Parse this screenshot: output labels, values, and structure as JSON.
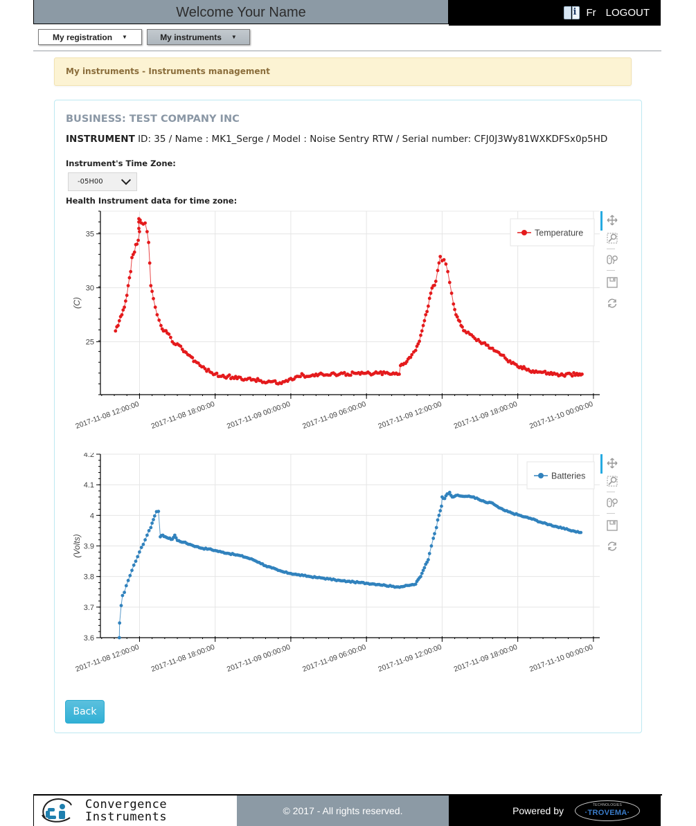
{
  "header": {
    "welcome": "Welcome  Your Name",
    "help_icon": "book-info-icon",
    "language": "Fr",
    "logout": "LOGOUT"
  },
  "menu": {
    "items": [
      {
        "label": "My registration",
        "icon": "caret-down-icon"
      },
      {
        "label": "My instruments",
        "icon": "caret-down-icon"
      }
    ]
  },
  "alert": {
    "text": "My instruments - Instruments management"
  },
  "panel": {
    "business": "BUSINESS: TEST COMPANY INC",
    "instrument_label": "INSTRUMENT",
    "instrument_details": " ID: 35 / Name : MK1_Serge / Model : Noise Sentry RTW / Serial number: CFJ0J3Wy81WXKDFSx0p5HD",
    "timezone_label": "Instrument's Time Zone:",
    "timezone_value": "-05H00",
    "health_label": "Health Instrument data for time zone:",
    "back_label": "Back"
  },
  "toolbar": {
    "tools": [
      "pan-icon",
      "box-zoom-icon",
      "wheel-zoom-icon",
      "save-icon",
      "reset-icon"
    ]
  },
  "chart_data": [
    {
      "type": "line",
      "title": "",
      "xlabel": "",
      "ylabel": "(C)",
      "legend": {
        "label": "Temperature",
        "placement": "top-right"
      },
      "color": "#e41a1c",
      "grid": true,
      "x_unit": "hours since 2017-11-08 12:00:00",
      "xlim": [
        -3.1,
        36.5
      ],
      "ylim": [
        20.1,
        37.1
      ],
      "x_ticks": [
        {
          "at": 0,
          "label": "2017-11-08 12:00:00"
        },
        {
          "at": 6,
          "label": "2017-11-08 18:00:00"
        },
        {
          "at": 12,
          "label": "2017-11-09 00:00:00"
        },
        {
          "at": 18,
          "label": "2017-11-09 06:00:00"
        },
        {
          "at": 24,
          "label": "2017-11-09 12:00:00"
        },
        {
          "at": 30,
          "label": "2017-11-09 18:00:00"
        },
        {
          "at": 36,
          "label": "2017-11-10 00:00:00"
        }
      ],
      "y_ticks": [
        25,
        30,
        35
      ],
      "series": [
        {
          "name": "Temperature",
          "points": [
            [
              -1.9,
              26.0
            ],
            [
              -1.7,
              26.5
            ],
            [
              -1.4,
              27.5
            ],
            [
              -1.2,
              28.2
            ],
            [
              -1.0,
              29.3
            ],
            [
              -0.9,
              30.2
            ],
            [
              -0.7,
              31.5
            ],
            [
              -0.6,
              32.8
            ],
            [
              -0.4,
              33.3
            ],
            [
              -0.3,
              34.0
            ],
            [
              -0.1,
              34.4
            ],
            [
              0.0,
              35.2
            ],
            [
              -0.05,
              35.5
            ],
            [
              -0.05,
              36.1
            ],
            [
              -0.05,
              36.4
            ],
            [
              0.15,
              36.0
            ],
            [
              0.3,
              35.9
            ],
            [
              0.45,
              36.0
            ],
            [
              0.6,
              35.2
            ],
            [
              0.72,
              34.2
            ],
            [
              0.9,
              30.2
            ],
            [
              1.1,
              29.0
            ],
            [
              1.25,
              28.2
            ],
            [
              1.4,
              27.5
            ],
            [
              1.55,
              27.0
            ],
            [
              1.7,
              26.5
            ],
            [
              1.9,
              26.0
            ],
            [
              2.2,
              25.8
            ],
            [
              2.6,
              25.0
            ],
            [
              3.0,
              24.8
            ],
            [
              3.4,
              24.3
            ],
            [
              3.7,
              24.0
            ],
            [
              4.1,
              23.6
            ],
            [
              4.4,
              23.2
            ],
            [
              4.8,
              22.8
            ],
            [
              5.2,
              22.5
            ],
            [
              5.6,
              22.2
            ],
            [
              6.0,
              22.0
            ],
            [
              6.5,
              21.8
            ],
            [
              7.0,
              21.8
            ],
            [
              7.5,
              21.6
            ],
            [
              8.0,
              21.7
            ],
            [
              8.5,
              21.5
            ],
            [
              9.0,
              21.5
            ],
            [
              9.5,
              21.4
            ],
            [
              10.0,
              21.2
            ],
            [
              10.5,
              21.3
            ],
            [
              11.0,
              21.1
            ],
            [
              11.5,
              21.3
            ],
            [
              12.0,
              21.6
            ],
            [
              12.5,
              21.8
            ],
            [
              13.0,
              21.9
            ],
            [
              13.5,
              21.8
            ],
            [
              14.0,
              22.0
            ],
            [
              14.5,
              22.0
            ],
            [
              15.0,
              21.9
            ],
            [
              15.5,
              22.0
            ],
            [
              16.0,
              22.1
            ],
            [
              16.5,
              22.0
            ],
            [
              17.0,
              22.1
            ],
            [
              17.5,
              22.0
            ],
            [
              18.0,
              22.1
            ],
            [
              18.5,
              22.0
            ],
            [
              19.0,
              22.1
            ],
            [
              19.5,
              22.1
            ],
            [
              20.0,
              22.0
            ],
            [
              20.6,
              22.0
            ],
            [
              20.7,
              22.8
            ],
            [
              21.0,
              23.0
            ],
            [
              21.3,
              23.4
            ],
            [
              21.6,
              23.8
            ],
            [
              21.9,
              24.2
            ],
            [
              22.1,
              24.8
            ],
            [
              22.3,
              25.6
            ],
            [
              22.5,
              26.5
            ],
            [
              22.7,
              27.5
            ],
            [
              22.9,
              28.3
            ],
            [
              23.1,
              29.5
            ],
            [
              23.3,
              30.2
            ],
            [
              23.5,
              30.6
            ],
            [
              23.65,
              31.6
            ],
            [
              23.75,
              32.3
            ],
            [
              23.85,
              32.9
            ],
            [
              24.0,
              32.5
            ],
            [
              24.15,
              32.6
            ],
            [
              24.3,
              32.2
            ],
            [
              24.45,
              31.5
            ],
            [
              24.6,
              30.5
            ],
            [
              24.75,
              29.5
            ],
            [
              24.9,
              28.5
            ],
            [
              25.1,
              27.5
            ],
            [
              25.3,
              27.0
            ],
            [
              25.5,
              26.5
            ],
            [
              25.8,
              26.0
            ],
            [
              26.2,
              25.7
            ],
            [
              26.6,
              25.3
            ],
            [
              27.0,
              25.0
            ],
            [
              27.5,
              24.7
            ],
            [
              28.0,
              24.4
            ],
            [
              28.5,
              24.0
            ],
            [
              29.0,
              23.5
            ],
            [
              29.5,
              23.0
            ],
            [
              30.0,
              22.7
            ],
            [
              30.6,
              22.5
            ],
            [
              31.2,
              22.3
            ],
            [
              31.8,
              22.2
            ],
            [
              32.4,
              22.1
            ],
            [
              33.0,
              22.0
            ],
            [
              33.6,
              21.9
            ],
            [
              34.2,
              22.0
            ],
            [
              34.8,
              21.9
            ],
            [
              35.1,
              22.0
            ]
          ]
        }
      ]
    },
    {
      "type": "line",
      "title": "",
      "xlabel": "",
      "ylabel": "(Volts)",
      "legend": {
        "label": "Batteries",
        "placement": "top-right"
      },
      "color": "#3182bd",
      "grid": true,
      "x_unit": "hours since 2017-11-08 12:00:00",
      "xlim": [
        -3.1,
        36.5
      ],
      "ylim": [
        3.6,
        4.2
      ],
      "x_ticks": [
        {
          "at": 0,
          "label": "2017-11-08 12:00:00"
        },
        {
          "at": 6,
          "label": "2017-11-08 18:00:00"
        },
        {
          "at": 12,
          "label": "2017-11-09 00:00:00"
        },
        {
          "at": 18,
          "label": "2017-11-09 06:00:00"
        },
        {
          "at": 24,
          "label": "2017-11-09 12:00:00"
        },
        {
          "at": 30,
          "label": "2017-11-09 18:00:00"
        },
        {
          "at": 36,
          "label": "2017-11-10 00:00:00"
        }
      ],
      "y_ticks": [
        3.6,
        3.7,
        3.8,
        3.9,
        4.0,
        4.1,
        4.2
      ],
      "y_tick_labels": [
        "3.6",
        "3.7",
        "3.8",
        "3.9",
        "4",
        "4.1",
        "4.2"
      ],
      "series": [
        {
          "name": "Batteries",
          "points": [
            [
              -1.6,
              3.6
            ],
            [
              -1.58,
              3.648
            ],
            [
              -1.45,
              3.705
            ],
            [
              -1.35,
              3.738
            ],
            [
              -1.2,
              3.748
            ],
            [
              -1.05,
              3.77
            ],
            [
              -0.9,
              3.787
            ],
            [
              -0.75,
              3.803
            ],
            [
              -0.6,
              3.82
            ],
            [
              -0.45,
              3.837
            ],
            [
              -0.3,
              3.85
            ],
            [
              -0.15,
              3.865
            ],
            [
              0.0,
              3.88
            ],
            [
              0.15,
              3.895
            ],
            [
              0.3,
              3.905
            ],
            [
              0.45,
              3.92
            ],
            [
              0.6,
              3.935
            ],
            [
              0.75,
              3.95
            ],
            [
              0.9,
              3.96
            ],
            [
              1.1,
              3.986
            ],
            [
              1.2,
              3.998
            ],
            [
              1.35,
              4.012
            ],
            [
              1.5,
              4.013
            ],
            [
              1.65,
              3.93
            ],
            [
              1.85,
              3.935
            ],
            [
              2.05,
              3.93
            ],
            [
              2.3,
              3.925
            ],
            [
              2.6,
              3.922
            ],
            [
              2.8,
              3.935
            ],
            [
              3.0,
              3.918
            ],
            [
              3.5,
              3.912
            ],
            [
              4.0,
              3.905
            ],
            [
              4.5,
              3.898
            ],
            [
              5.0,
              3.892
            ],
            [
              5.5,
              3.89
            ],
            [
              6.0,
              3.885
            ],
            [
              6.5,
              3.88
            ],
            [
              7.0,
              3.876
            ],
            [
              7.5,
              3.872
            ],
            [
              8.0,
              3.868
            ],
            [
              8.5,
              3.862
            ],
            [
              9.0,
              3.855
            ],
            [
              9.5,
              3.846
            ],
            [
              10.0,
              3.835
            ],
            [
              10.5,
              3.828
            ],
            [
              11.0,
              3.82
            ],
            [
              11.5,
              3.814
            ],
            [
              12.0,
              3.81
            ],
            [
              12.5,
              3.806
            ],
            [
              13.0,
              3.803
            ],
            [
              13.5,
              3.8
            ],
            [
              14.0,
              3.797
            ],
            [
              14.5,
              3.795
            ],
            [
              15.0,
              3.792
            ],
            [
              15.5,
              3.789
            ],
            [
              16.0,
              3.786
            ],
            [
              16.5,
              3.784
            ],
            [
              17.0,
              3.782
            ],
            [
              17.5,
              3.78
            ],
            [
              18.0,
              3.778
            ],
            [
              18.5,
              3.776
            ],
            [
              19.0,
              3.774
            ],
            [
              19.5,
              3.771
            ],
            [
              20.0,
              3.768
            ],
            [
              20.5,
              3.766
            ],
            [
              21.0,
              3.768
            ],
            [
              21.5,
              3.772
            ],
            [
              21.9,
              3.775
            ],
            [
              22.1,
              3.79
            ],
            [
              22.3,
              3.8
            ],
            [
              22.5,
              3.82
            ],
            [
              22.7,
              3.84
            ],
            [
              22.9,
              3.855
            ],
            [
              23.0,
              3.875
            ],
            [
              23.15,
              3.9
            ],
            [
              23.3,
              3.925
            ],
            [
              23.4,
              3.94
            ],
            [
              23.55,
              3.96
            ],
            [
              23.65,
              3.985
            ],
            [
              23.75,
              4.0
            ],
            [
              23.85,
              4.015
            ],
            [
              23.95,
              4.03
            ],
            [
              24.0,
              4.06
            ],
            [
              24.2,
              4.055
            ],
            [
              24.4,
              4.07
            ],
            [
              24.6,
              4.075
            ],
            [
              24.8,
              4.06
            ],
            [
              25.1,
              4.065
            ],
            [
              25.5,
              4.063
            ],
            [
              26.0,
              4.062
            ],
            [
              26.5,
              4.06
            ],
            [
              27.0,
              4.05
            ],
            [
              27.5,
              4.042
            ],
            [
              28.0,
              4.04
            ],
            [
              28.5,
              4.025
            ],
            [
              29.0,
              4.015
            ],
            [
              29.5,
              4.008
            ],
            [
              30.0,
              4.002
            ],
            [
              30.5,
              3.995
            ],
            [
              31.0,
              3.99
            ],
            [
              31.5,
              3.983
            ],
            [
              32.0,
              3.975
            ],
            [
              32.5,
              3.97
            ],
            [
              33.0,
              3.964
            ],
            [
              33.5,
              3.958
            ],
            [
              34.0,
              3.953
            ],
            [
              34.5,
              3.948
            ],
            [
              35.0,
              3.944
            ]
          ]
        }
      ]
    }
  ],
  "footer": {
    "logo_line1": "Convergence",
    "logo_line2": "Instruments",
    "copyright": "© 2017 - All rights reserved.",
    "powered_by": "Powered by",
    "partner_small": "TECHNOLOGIES",
    "partner_name": "·TROVEMA·"
  }
}
